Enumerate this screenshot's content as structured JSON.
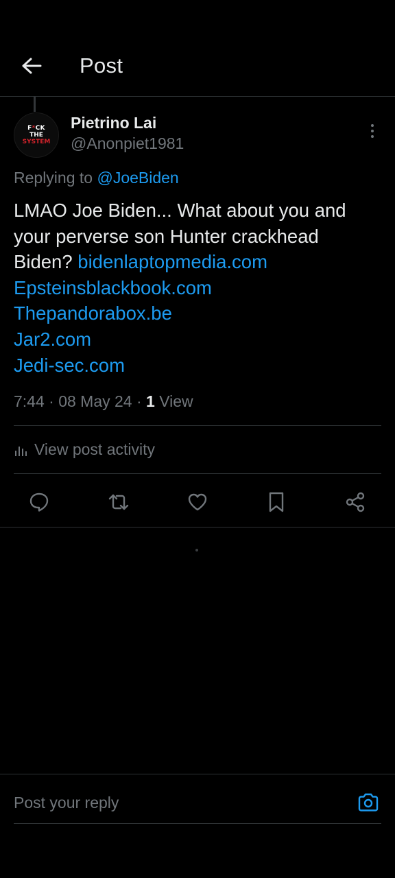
{
  "header": {
    "title": "Post"
  },
  "post": {
    "author": {
      "display_name": "Pietrino Lai",
      "handle": "@Anonpiet1981",
      "avatar_text": {
        "line1_a": "F",
        "line1_b": "*",
        "line1_c": "CK",
        "line2": "THE",
        "line3": "SYSTEM"
      }
    },
    "replying_prefix": "Replying to",
    "replying_to": "@JoeBiden",
    "text": {
      "line1": "LMAO Joe Biden...  What about you and",
      "line2": "your perverse son Hunter crackhead",
      "line3_text": "Biden? ",
      "line3_link": "bidenlaptopmedia.com",
      "links": [
        "Epsteinsblackbook.com",
        "Thepandorabox.be",
        "Jar2.com",
        "Jedi-sec.com"
      ]
    },
    "meta": {
      "time_date": "7:44 · 08 May 24 · ",
      "views_count": "1",
      "views_label": " View"
    },
    "activity_label": "View post activity"
  },
  "actions": {
    "icons": [
      "reply-icon",
      "repost-icon",
      "like-icon",
      "bookmark-icon",
      "share-icon"
    ]
  },
  "composer": {
    "placeholder": "Post your reply"
  },
  "colors": {
    "background": "#000000",
    "text": "#e7e9ea",
    "muted": "#71767b",
    "link": "#1d9bf0",
    "divider": "#2f3336",
    "avatar_red": "#d4232b"
  }
}
